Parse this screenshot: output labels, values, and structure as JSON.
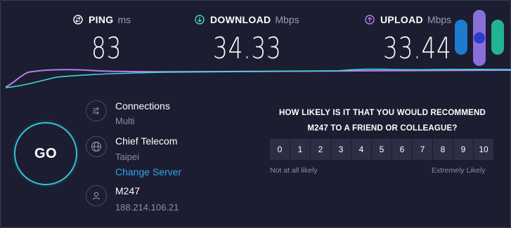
{
  "metrics": {
    "ping": {
      "label": "PING",
      "unit": "ms",
      "value": "83"
    },
    "download": {
      "label": "DOWNLOAD",
      "unit": "Mbps",
      "value": "34.33"
    },
    "upload": {
      "label": "UPLOAD",
      "unit": "Mbps",
      "value": "33.44"
    }
  },
  "colors": {
    "ping_icon": "#ffffff",
    "download_accent": "#3ed9d1",
    "upload_accent": "#b47ef5",
    "go_ring": "#2fc3d4",
    "link": "#2ea6f0",
    "logo_blue": "#1e7bd0",
    "logo_purple": "#8a6fd8",
    "logo_teal": "#22b391"
  },
  "go_button": {
    "label": "GO"
  },
  "server": {
    "connections": {
      "title": "Connections",
      "value": "Multi",
      "icon": "connections-icon"
    },
    "host": {
      "title": "Chief Telecom",
      "location": "Taipei",
      "change_link": "Change Server",
      "icon": "globe-icon"
    },
    "user": {
      "title": "M247",
      "ip": "188.214.106.21",
      "icon": "user-icon"
    }
  },
  "survey": {
    "question_line1": "HOW LIKELY IS IT THAT YOU WOULD RECOMMEND",
    "question_line2": "M247 TO A FRIEND OR COLLEAGUE?",
    "scale": [
      "0",
      "1",
      "2",
      "3",
      "4",
      "5",
      "6",
      "7",
      "8",
      "9",
      "10"
    ],
    "low_label": "Not at all likely",
    "high_label": "Extremely Likely"
  }
}
